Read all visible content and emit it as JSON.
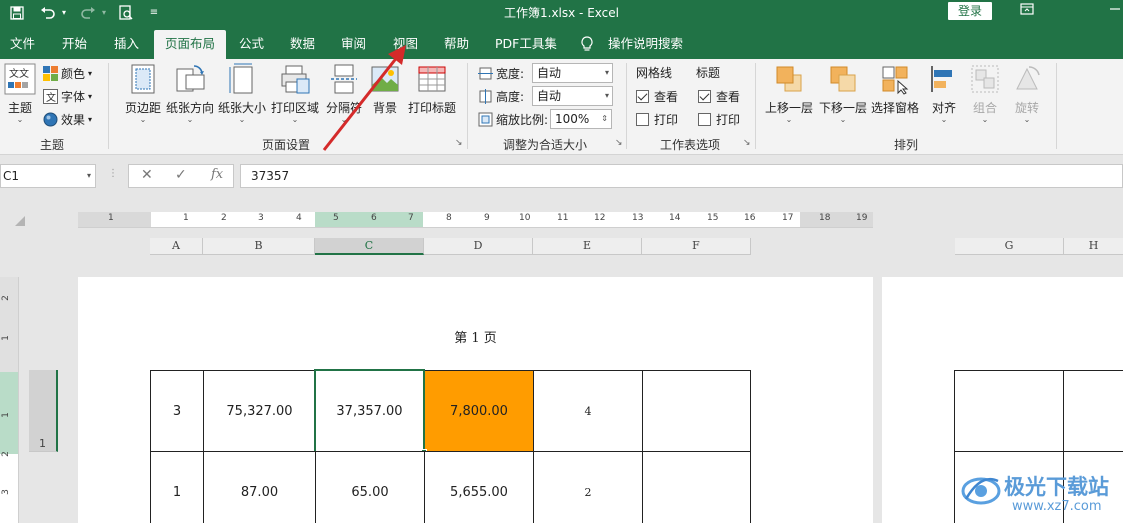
{
  "window": {
    "doc_title": "工作簿1.xlsx  -  Excel",
    "login_label": "登录"
  },
  "tabs": [
    "文件",
    "开始",
    "插入",
    "页面布局",
    "公式",
    "数据",
    "审阅",
    "视图",
    "帮助",
    "PDF工具集",
    "操作说明搜索"
  ],
  "active_tab": "页面布局",
  "ribbon": {
    "theme_group": {
      "label": "主题",
      "theme_btn": "主题",
      "colors": "颜色",
      "fonts": "字体",
      "effects": "效果"
    },
    "page_setup": {
      "label": "页面设置",
      "buttons": [
        "页边距",
        "纸张方向",
        "纸张大小",
        "打印区域",
        "分隔符",
        "背景",
        "打印标题"
      ]
    },
    "scale_to_fit": {
      "label": "调整为合适大小",
      "width_label": "宽度:",
      "width_value": "自动",
      "height_label": "高度:",
      "height_value": "自动",
      "scale_label": "缩放比例:",
      "scale_value": "100%"
    },
    "sheet_options": {
      "label": "工作表选项",
      "gridlines": "网格线",
      "headings": "标题",
      "view": "查看",
      "print": "打印",
      "gridlines_view": true,
      "gridlines_print": false,
      "headings_view": true,
      "headings_print": false
    },
    "arrange": {
      "label": "排列",
      "buttons": [
        "上移一层",
        "下移一层",
        "选择窗格",
        "对齐",
        "组合",
        "旋转"
      ]
    }
  },
  "formula_bar": {
    "name_box": "C1",
    "formula": "37357",
    "cancel": "✕",
    "enter": "✓",
    "fx": "fx"
  },
  "ruler_top_numbers": [
    "1",
    "1",
    "2",
    "3",
    "4",
    "5",
    "6",
    "7",
    "8",
    "9",
    "10",
    "11",
    "12",
    "13",
    "14",
    "15",
    "16",
    "17",
    "18",
    "19"
  ],
  "ruler_left_numbers": [
    "2",
    "1",
    "1",
    "2",
    "3"
  ],
  "columns": [
    "A",
    "B",
    "C",
    "D",
    "E",
    "F",
    "G",
    "H"
  ],
  "selected_column": "C",
  "row_header": "1",
  "page_label": "第 1 页",
  "rows": [
    [
      "3",
      "75,327.00",
      "37,357.00",
      "7,800.00",
      "4",
      ""
    ],
    [
      "1",
      "87.00",
      "65.00",
      "5,655.00",
      "2",
      ""
    ]
  ],
  "watermark": {
    "title": "极光下载站",
    "url": "www.xz7.com"
  },
  "colors": {
    "excel_green": "#217346",
    "highlight_orange": "#ff9c00",
    "arrow_red": "#d42a2a"
  }
}
